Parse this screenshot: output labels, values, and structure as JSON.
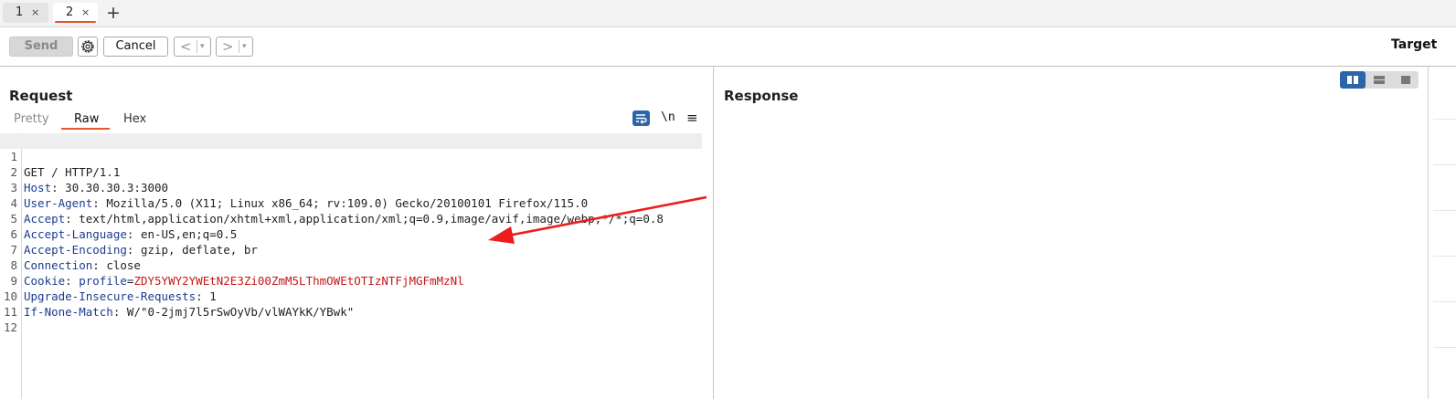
{
  "tabs": [
    {
      "label": "1",
      "close": "×"
    },
    {
      "label": "2",
      "close": "×"
    }
  ],
  "new_tab": "+",
  "toolbar": {
    "send": "Send",
    "cancel": "Cancel",
    "back": "<",
    "forward": ">",
    "dropdown": "▾",
    "target": "Target"
  },
  "request": {
    "title": "Request",
    "subtabs": [
      "Pretty",
      "Raw",
      "Hex"
    ],
    "newline_toggle": "\\n",
    "menu": "≡",
    "lines": [
      {
        "n": "1",
        "name": "",
        "sep": "",
        "value": "GET / HTTP/1.1"
      },
      {
        "n": "2",
        "name": "Host",
        "sep": ": ",
        "value": "30.30.30.3:3000"
      },
      {
        "n": "3",
        "name": "User-Agent",
        "sep": ": ",
        "value": "Mozilla/5.0 (X11; Linux x86_64; rv:109.0) Gecko/20100101 Firefox/115.0"
      },
      {
        "n": "4",
        "name": "Accept",
        "sep": ": ",
        "value": "text/html,application/xhtml+xml,application/xml;q=0.9,image/avif,image/webp,*/*;q=0.8"
      },
      {
        "n": "5",
        "name": "Accept-Language",
        "sep": ": ",
        "value": "en-US,en;q=0.5"
      },
      {
        "n": "6",
        "name": "Accept-Encoding",
        "sep": ": ",
        "value": "gzip, deflate, br"
      },
      {
        "n": "7",
        "name": "Connection",
        "sep": ": ",
        "value": "close"
      },
      {
        "n": "8",
        "name": "Cookie",
        "sep": ": ",
        "value": ""
      },
      {
        "n": "9",
        "name": "Upgrade-Insecure-Requests",
        "sep": ": ",
        "value": "1"
      },
      {
        "n": "10",
        "name": "If-None-Match",
        "sep": ": ",
        "value": "W/\"0-2jmj7l5rSwOyVb/vlWAYkK/YBwk\""
      },
      {
        "n": "11",
        "name": "",
        "sep": "",
        "value": ""
      },
      {
        "n": "12",
        "name": "",
        "sep": "",
        "value": ""
      }
    ],
    "cookie": {
      "name": "profile",
      "eq": "=",
      "value": "ZDY5YWY2YWEtN2E3Zi00ZmM5LThmOWEtOTIzNTFjMGFmMzNl"
    }
  },
  "response": {
    "title": "Response"
  },
  "colors": {
    "accent": "#e6542b",
    "header_name": "#1a3d8f",
    "cookie_value": "#c61717",
    "annotation_arrow": "#ee1c1c",
    "toggle_active": "#2b66a8"
  },
  "icons": [
    "gear-icon",
    "wrap-lines-icon",
    "menu-icon",
    "split-horizontal-icon",
    "split-vertical-icon",
    "single-panel-icon",
    "annotation-arrow"
  ]
}
